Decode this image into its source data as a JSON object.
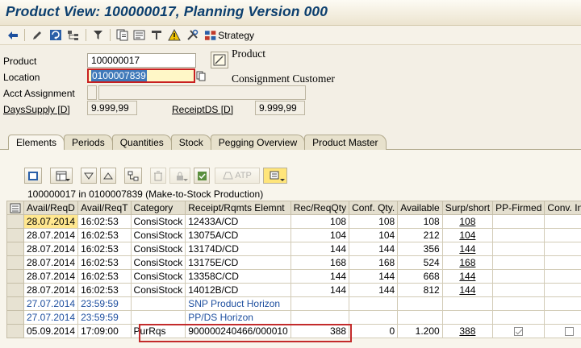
{
  "window": {
    "title": "Product View: 100000017, Planning Version 000"
  },
  "toolbar": {
    "icons": [
      "back-arrow-icon",
      "pencil-icon",
      "refresh-icon",
      "hierarchy-icon",
      "filter-icon",
      "documents-icon",
      "plan-icon",
      "bom-icon",
      "alert-icon",
      "tools-icon",
      "strategy-icon"
    ],
    "strategy_label": "Strategy"
  },
  "header": {
    "product_label": "Product",
    "product_value": "100000017",
    "product_desc": "Product",
    "location_label": "Location",
    "location_value": "0100007839",
    "location_desc": "Consignment Customer",
    "acct_label": "Acct Assignment",
    "acct_value": "",
    "acct_desc": "",
    "dayssupply_label": "DaysSupply [D]",
    "dayssupply_value": "9.999,99",
    "receiptds_label": "ReceiptDS [D]",
    "receiptds_value": "9.999,99"
  },
  "tabs": [
    "Elements",
    "Periods",
    "Quantities",
    "Stock",
    "Pegging Overview",
    "Product Master"
  ],
  "grid_toolbar": {
    "atp_label": "ATP"
  },
  "grid": {
    "title": "100000017 in 0100007839 (Make-to-Stock Production)",
    "columns": [
      "Avail/ReqD",
      "Avail/ReqT",
      "Category",
      "Receipt/Rqmts Elemnt",
      "Rec/ReqQty",
      "Conf. Qty.",
      "Available",
      "Surp/short",
      "PP-Firmed",
      "Conv. Ind."
    ],
    "rows": [
      {
        "date": "28.07.2014",
        "time": "16:02:53",
        "category": "ConsiStock",
        "element": "12433A/CD",
        "recqty": "108",
        "conf": "108",
        "avail": "108",
        "surp": "108",
        "firmed": "",
        "conv": ""
      },
      {
        "date": "28.07.2014",
        "time": "16:02:53",
        "category": "ConsiStock",
        "element": "13075A/CD",
        "recqty": "104",
        "conf": "104",
        "avail": "212",
        "surp": "104",
        "firmed": "",
        "conv": ""
      },
      {
        "date": "28.07.2014",
        "time": "16:02:53",
        "category": "ConsiStock",
        "element": "13174D/CD",
        "recqty": "144",
        "conf": "144",
        "avail": "356",
        "surp": "144",
        "firmed": "",
        "conv": ""
      },
      {
        "date": "28.07.2014",
        "time": "16:02:53",
        "category": "ConsiStock",
        "element": "13175E/CD",
        "recqty": "168",
        "conf": "168",
        "avail": "524",
        "surp": "168",
        "firmed": "",
        "conv": ""
      },
      {
        "date": "28.07.2014",
        "time": "16:02:53",
        "category": "ConsiStock",
        "element": "13358C/CD",
        "recqty": "144",
        "conf": "144",
        "avail": "668",
        "surp": "144",
        "firmed": "",
        "conv": ""
      },
      {
        "date": "28.07.2014",
        "time": "16:02:53",
        "category": "ConsiStock",
        "element": "14012B/CD",
        "recqty": "144",
        "conf": "144",
        "avail": "812",
        "surp": "144",
        "firmed": "",
        "conv": ""
      },
      {
        "date": "27.07.2014",
        "time": "23:59:59",
        "category": "",
        "element": "SNP Product Horizon",
        "recqty": "",
        "conf": "",
        "avail": "",
        "surp": "",
        "firmed": "",
        "conv": ""
      },
      {
        "date": "27.07.2014",
        "time": "23:59:59",
        "category": "",
        "element": "PP/DS Horizon",
        "recqty": "",
        "conf": "",
        "avail": "",
        "surp": "",
        "firmed": "",
        "conv": ""
      },
      {
        "date": "05.09.2014",
        "time": "17:09:00",
        "category": "PurRqs",
        "element": "900000240466/000010",
        "recqty": "388",
        "conf": "0",
        "avail": "1.200",
        "surp": "388",
        "firmed": "checked",
        "conv": "unchecked"
      }
    ]
  }
}
